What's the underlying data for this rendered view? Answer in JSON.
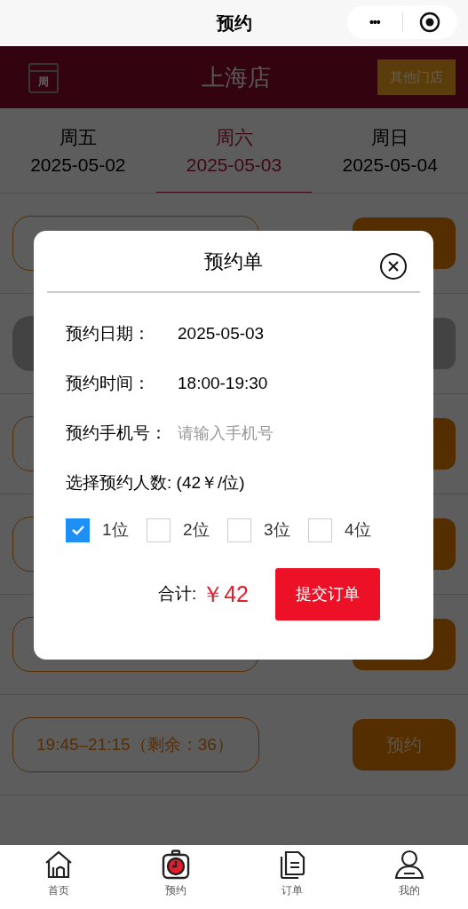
{
  "nav_bar": {
    "title": "预约",
    "menu_dots": "•••"
  },
  "store_bar": {
    "calendar_label": "周",
    "store_name": "上海店",
    "switch_button": "其他门店"
  },
  "date_tabs": [
    {
      "weekday": "周五",
      "date": "2025-05-02",
      "selected": false
    },
    {
      "weekday": "周六",
      "date": "2025-05-03",
      "selected": true
    },
    {
      "weekday": "周日",
      "date": "2025-05-04",
      "selected": false
    }
  ],
  "slots": [
    {
      "disabled": false
    },
    {
      "disabled": true
    },
    {
      "disabled": false
    },
    {
      "disabled": false
    },
    {
      "disabled": false
    },
    {
      "time": "19:45–21:15（剩余：36）",
      "button": "预约",
      "disabled": false
    }
  ],
  "dialog": {
    "title": "预约单",
    "fields": [
      {
        "label": "预约日期：",
        "value": "2025-05-03"
      },
      {
        "label": "预约时间：",
        "value": "18:00-19:30"
      }
    ],
    "phone": {
      "label": "预约手机号：",
      "placeholder": "请输入手机号"
    },
    "count_label": "选择预约人数: (42￥/位)",
    "options": [
      {
        "label": "1位",
        "checked": true
      },
      {
        "label": "2位",
        "checked": false
      },
      {
        "label": "3位",
        "checked": false
      },
      {
        "label": "4位",
        "checked": false
      }
    ],
    "total_label": "合计:",
    "total_value": "￥42",
    "submit": "提交订单"
  },
  "tab_bar": [
    {
      "label": "首页",
      "kind": "home",
      "selected": false
    },
    {
      "label": "预约",
      "kind": "timer",
      "selected": true
    },
    {
      "label": "订单",
      "kind": "docs",
      "selected": false
    },
    {
      "label": "我的",
      "kind": "user",
      "selected": false
    }
  ]
}
